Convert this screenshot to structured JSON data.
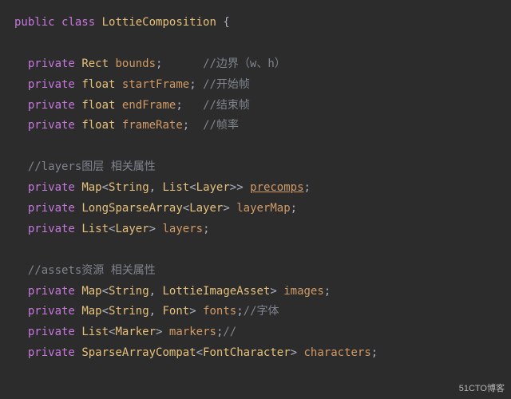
{
  "code": {
    "l1": {
      "kw1": "public",
      "kw2": "class",
      "name": "LottieComposition",
      "brace": " {"
    },
    "l3": {
      "kw": "private",
      "type": "Rect",
      "id": "bounds",
      "semi": ";",
      "pad": "      ",
      "comment": "//边界（w、h）"
    },
    "l4": {
      "kw": "private",
      "type": "float",
      "id": "startFrame",
      "semi": ";",
      "pad": " ",
      "comment": "//开始帧"
    },
    "l5": {
      "kw": "private",
      "type": "float",
      "id": "endFrame",
      "semi": ";",
      "pad": "   ",
      "comment": "//结束帧"
    },
    "l6": {
      "kw": "private",
      "type": "float",
      "id": "frameRate",
      "semi": ";",
      "pad": "  ",
      "comment": "//帧率"
    },
    "l8": {
      "comment": "//layers图层 相关属性"
    },
    "l9": {
      "kw": "private",
      "t1": "Map",
      "lt": "<",
      "t2": "String",
      "comma": ", ",
      "t3": "List",
      "lt2": "<",
      "t4": "Layer",
      "gt2": ">>",
      "sp": " ",
      "id": "precomps",
      "semi": ";"
    },
    "l10": {
      "kw": "private",
      "t1": "LongSparseArray",
      "lt": "<",
      "t2": "Layer",
      "gt": ">",
      "sp": " ",
      "id": "layerMap",
      "semi": ";"
    },
    "l11": {
      "kw": "private",
      "t1": "List",
      "lt": "<",
      "t2": "Layer",
      "gt": ">",
      "sp": " ",
      "id": "layers",
      "semi": ";"
    },
    "l13": {
      "comment": "//assets资源 相关属性"
    },
    "l14": {
      "kw": "private",
      "t1": "Map",
      "lt": "<",
      "t2": "String",
      "comma": ", ",
      "t3": "LottieImageAsset",
      "gt": ">",
      "sp": " ",
      "id": "images",
      "semi": ";"
    },
    "l15": {
      "kw": "private",
      "t1": "Map",
      "lt": "<",
      "t2": "String",
      "comma": ", ",
      "t3": "Font",
      "gt": ">",
      "sp": " ",
      "id": "fonts",
      "semi": ";",
      "comment": "//字体"
    },
    "l16": {
      "kw": "private",
      "t1": "List",
      "lt": "<",
      "t2": "Marker",
      "gt": ">",
      "sp": " ",
      "id": "markers",
      "semi": ";",
      "comment": "//"
    },
    "l17": {
      "kw": "private",
      "t1": "SparseArrayCompat",
      "lt": "<",
      "t2": "FontCharacter",
      "gt": ">",
      "sp": " ",
      "id": "characters",
      "semi": ";"
    }
  },
  "watermark": "51CTO博客"
}
